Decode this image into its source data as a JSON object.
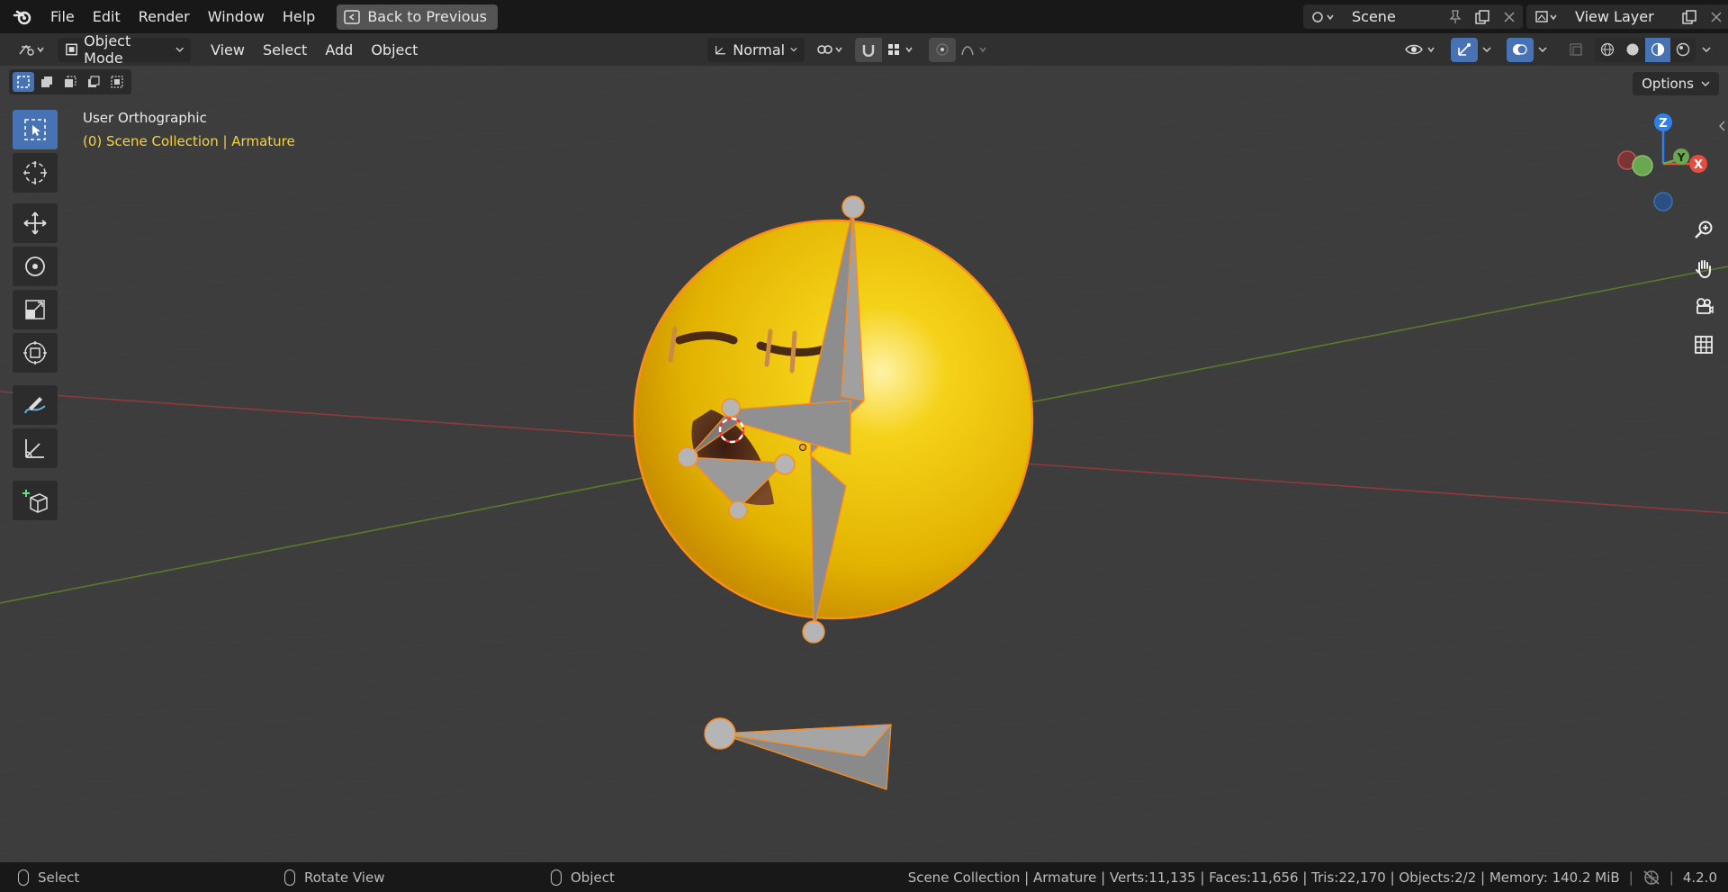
{
  "topbar": {
    "menus": [
      "File",
      "Edit",
      "Render",
      "Window",
      "Help"
    ],
    "back_label": "Back to Previous",
    "scene_name": "Scene",
    "view_layer": "View Layer"
  },
  "header": {
    "mode": "Object Mode",
    "menus": [
      "View",
      "Select",
      "Add",
      "Object"
    ],
    "orientation": "Normal"
  },
  "viewport": {
    "view_name": "User Orthographic",
    "collection_info": "(0) Scene Collection | Armature",
    "options_label": "Options",
    "axes": {
      "z": "Z",
      "y": "Y",
      "x": "X"
    }
  },
  "statusbar": {
    "hints": [
      "Select",
      "Rotate View",
      "Object"
    ],
    "info": "Scene Collection | Armature | Verts:11,135 | Faces:11,656 | Tris:22,170 | Objects:2/2 | Memory: 140.2 MiB",
    "version": "4.2.0"
  },
  "colors": {
    "accent": "#4772b3",
    "selection_outline": "#ff8c1a",
    "collection_text": "#f5d33e",
    "axis_x": "#e74c3c",
    "axis_y": "#6aa84f",
    "axis_z": "#2f80ed"
  }
}
